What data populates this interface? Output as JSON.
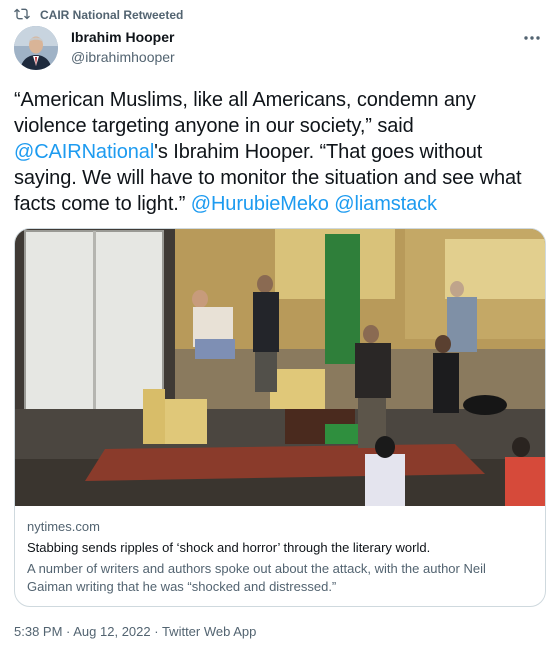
{
  "retweet": {
    "label": "CAIR National Retweeted",
    "icon": "retweet-icon"
  },
  "author": {
    "name": "Ibrahim Hooper",
    "handle": "@ibrahimhooper",
    "avatar_icon": "avatar"
  },
  "tweet": {
    "text_part1": "“American Muslims, like all Americans, condemn any violence targeting anyone in our society,” said ",
    "mention1": "@CAIRNational",
    "text_part2": "'s Ibrahim Hooper. “That goes without saying. We will have to monitor the situation and see what facts come to light.” ",
    "mention2": "@HurubieMeko",
    "mention3": "@liamstack"
  },
  "card": {
    "domain": "nytimes.com",
    "title": "Stabbing sends ripples of ‘shock and horror’ through the literary world.",
    "description": "A number of writers and authors spoke out about the attack, with the author Neil Gaiman writing that he was “shocked and distressed.”"
  },
  "meta": {
    "time": "5:38 PM",
    "separator1": " · ",
    "date": "Aug 12, 2022",
    "separator2": " · ",
    "source": "Twitter Web App"
  },
  "colors": {
    "link": "#1d9bf0",
    "secondary_text": "#536471",
    "border": "#cfd9de"
  }
}
